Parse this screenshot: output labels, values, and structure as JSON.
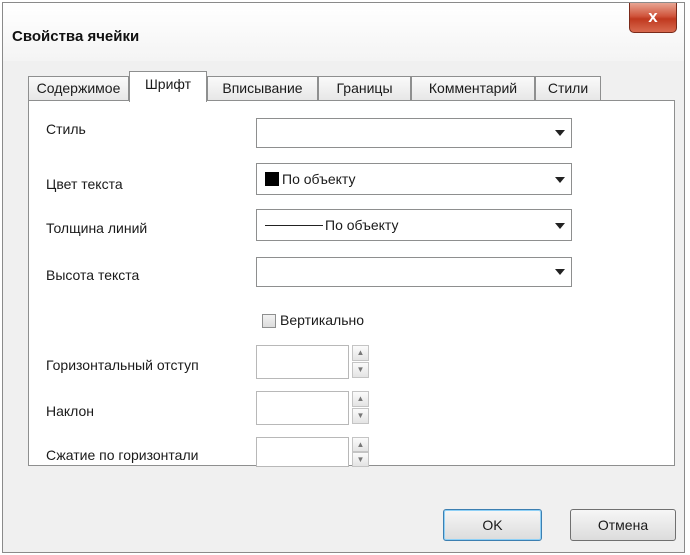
{
  "window": {
    "title": "Свойства ячейки",
    "close_label": "x"
  },
  "tabs": [
    {
      "label": "Содержимое"
    },
    {
      "label": "Шрифт"
    },
    {
      "label": "Вписывание"
    },
    {
      "label": "Границы"
    },
    {
      "label": "Комментарий"
    },
    {
      "label": "Стили"
    }
  ],
  "active_tab": "Шрифт",
  "form": {
    "style": {
      "label": "Стиль",
      "value": ""
    },
    "text_color": {
      "label": "Цвет текста",
      "value": "По объекту",
      "swatch_color": "#000000"
    },
    "line_weight": {
      "label": "Толщина линий",
      "value": "По объекту"
    },
    "text_height": {
      "label": "Высота текста",
      "value": ""
    },
    "vertical": {
      "label": "Вертикально",
      "checked": false
    },
    "horizontal_indent": {
      "label": "Горизонтальный отступ",
      "value": ""
    },
    "slant": {
      "label": "Наклон",
      "value": ""
    },
    "horizontal_compression": {
      "label": "Сжатие по горизонтали",
      "value": ""
    }
  },
  "buttons": {
    "ok": "OK",
    "cancel": "Отмена"
  }
}
